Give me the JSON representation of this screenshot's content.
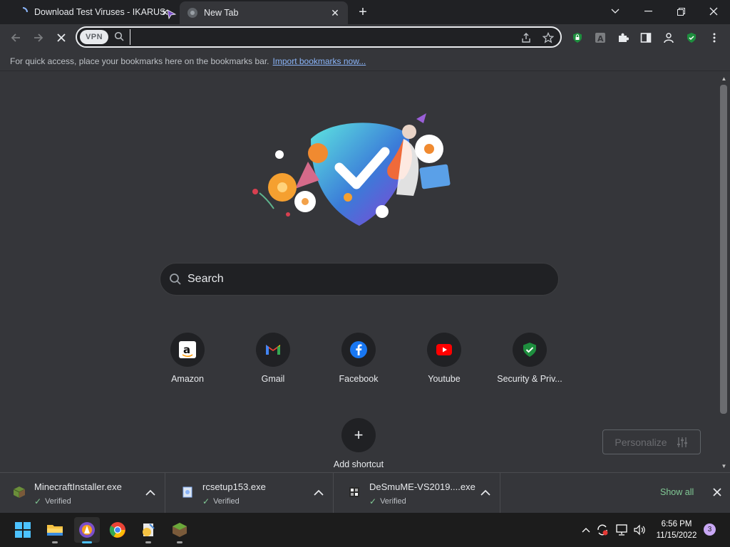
{
  "tabs": [
    {
      "title": "Download Test Viruses - IKARUS",
      "state": "loading",
      "close": "✕"
    },
    {
      "title": "New Tab",
      "state": "active",
      "close": "✕"
    }
  ],
  "newtab_label": "+",
  "window_controls": [
    "chevron-down",
    "minimize",
    "restore",
    "close"
  ],
  "toolbar": {
    "vpn_label": "VPN",
    "omnibox_value": "",
    "extensions": [
      "lock-shield-icon",
      "translate-icon",
      "puzzle-icon",
      "sidepanel-icon",
      "profile-icon",
      "security-shield-icon",
      "menu-icon"
    ]
  },
  "bookmarks_bar": {
    "text": "For quick access, place your bookmarks here on the bookmarks bar.",
    "link": "Import bookmarks now..."
  },
  "search": {
    "placeholder": "Search"
  },
  "shortcuts": [
    {
      "label": "Amazon",
      "icon": "amazon-icon"
    },
    {
      "label": "Gmail",
      "icon": "gmail-icon"
    },
    {
      "label": "Facebook",
      "icon": "facebook-icon"
    },
    {
      "label": "Youtube",
      "icon": "youtube-icon"
    },
    {
      "label": "Security & Priv...",
      "icon": "shield-check-icon"
    }
  ],
  "add_shortcut": {
    "label": "Add shortcut",
    "symbol": "+"
  },
  "personalize_label": "Personalize",
  "downloads": [
    {
      "name": "MinecraftInstaller.exe",
      "status": "Verified"
    },
    {
      "name": "rcsetup153.exe",
      "status": "Verified"
    },
    {
      "name": "DeSmuME-VS2019....exe",
      "status": "Verified"
    }
  ],
  "show_all": "Show all",
  "taskbar": {
    "apps": [
      "windows-start-icon",
      "file-explorer-icon",
      "avast-browser-icon",
      "chrome-icon",
      "installer-app-icon",
      "minecraft-icon"
    ],
    "time": "6:56 PM",
    "date": "11/15/2022",
    "notifications": "3"
  },
  "colors": {
    "accent_green": "#81c995",
    "link_blue": "#8ab4f8",
    "bg": "#35363a",
    "dark": "#202124"
  }
}
